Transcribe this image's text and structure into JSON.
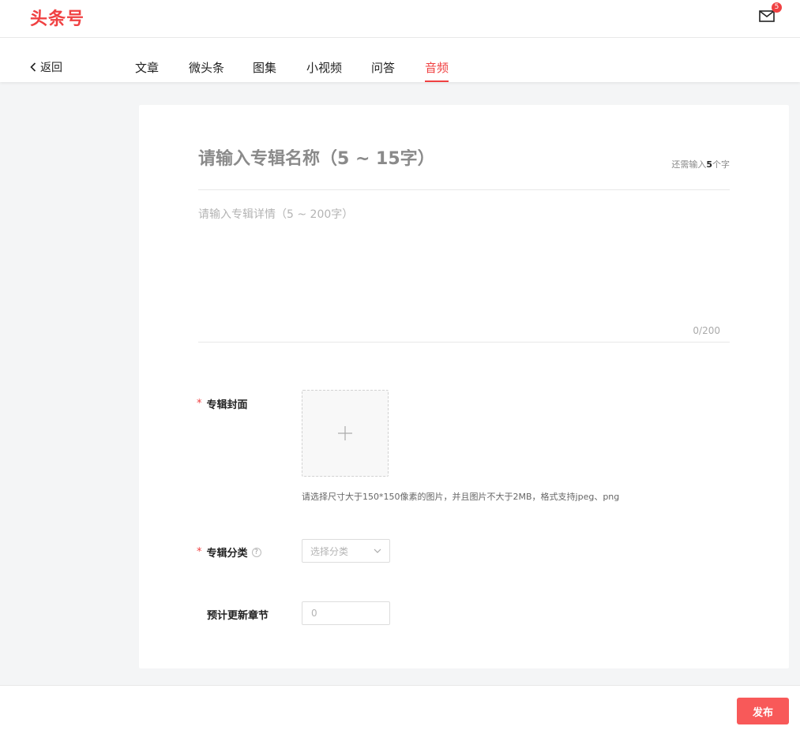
{
  "header": {
    "logo": "头条号",
    "mail_badge": "5"
  },
  "nav": {
    "back_label": "返回",
    "tabs": [
      {
        "label": "文章",
        "active": false
      },
      {
        "label": "微头条",
        "active": false
      },
      {
        "label": "图集",
        "active": false
      },
      {
        "label": "小视频",
        "active": false
      },
      {
        "label": "问答",
        "active": false
      },
      {
        "label": "音频",
        "active": true
      }
    ]
  },
  "form": {
    "title_placeholder": "请输入专辑名称（5 ~ 15字）",
    "title_remain_prefix": "还需输入",
    "title_remain_count": "5",
    "title_remain_suffix": "个字",
    "detail_placeholder": "请输入专辑详情（5 ~ 200字）",
    "detail_count": "0/200",
    "cover_label": "专辑封面",
    "cover_hint": "请选择尺寸大于150*150像素的图片，并且图片不大于2MB，格式支持jpeg、png",
    "category_label": "专辑分类",
    "category_placeholder": "选择分类",
    "chapters_label": "预计更新章节",
    "chapters_placeholder": "0",
    "required_mark": "*",
    "help_mark": "?"
  },
  "footer": {
    "publish_label": "发布"
  },
  "colors": {
    "brand": "#f04142",
    "publish": "#f85959"
  }
}
